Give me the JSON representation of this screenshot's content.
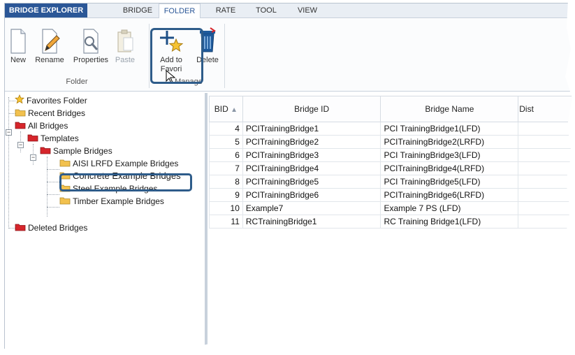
{
  "tabs": [
    "BRIDGE EXPLORER",
    "BRIDGE",
    "FOLDER",
    "RATE",
    "TOOL",
    "VIEW"
  ],
  "active_tab": "FOLDER",
  "ribbon": {
    "folder_group": {
      "label": "Folder",
      "buttons": [
        {
          "label": "New",
          "icon": "new-document-icon",
          "enabled": true
        },
        {
          "label": "Rename",
          "icon": "rename-pencil-icon",
          "enabled": true
        },
        {
          "label": "Properties",
          "icon": "properties-icon",
          "enabled": true
        },
        {
          "label": "Paste",
          "icon": "paste-icon",
          "enabled": false
        }
      ]
    },
    "manage_group": {
      "label": "Manage",
      "buttons": [
        {
          "label_line1": "Add to",
          "label_line2": "Favori",
          "icon": "add-star-icon",
          "enabled": true
        },
        {
          "label": "Delete",
          "icon": "trash-icon",
          "enabled": true
        }
      ]
    }
  },
  "tree": {
    "nodes": [
      {
        "label": "Favorites Folder",
        "icon": "star-icon"
      },
      {
        "label": "Recent Bridges",
        "icon": "folder-icon"
      },
      {
        "label": "All Bridges",
        "icon": "red-folder-icon"
      },
      {
        "label": "Templates",
        "icon": "red-folder-icon"
      },
      {
        "label": "Sample Bridges",
        "icon": "red-folder-icon"
      },
      {
        "label": "AISI LRFD Example Bridges",
        "icon": "folder-icon"
      },
      {
        "label": "Concrete Example Bridges",
        "icon": "folder-icon"
      },
      {
        "label": "Steel Example Bridges",
        "icon": "folder-icon"
      },
      {
        "label": "Timber Example Bridges",
        "icon": "folder-icon"
      },
      {
        "label": "Deleted Bridges",
        "icon": "red-folder-icon"
      }
    ],
    "selected": "Concrete Example Bridges"
  },
  "grid": {
    "columns": [
      "BID",
      "Bridge ID",
      "Bridge Name",
      "Dist"
    ],
    "sort_indicator": "▲",
    "rows": [
      {
        "bid": "4",
        "bridge_id": "PCITrainingBridge1",
        "bridge_name": "PCI TrainingBridge1(LFD)"
      },
      {
        "bid": "5",
        "bridge_id": "PCITrainingBridge2",
        "bridge_name": "PCITrainingBridge2(LRFD)"
      },
      {
        "bid": "6",
        "bridge_id": "PCITrainingBridge3",
        "bridge_name": "PCI TrainingBridge3(LFD)"
      },
      {
        "bid": "7",
        "bridge_id": "PCITrainingBridge4",
        "bridge_name": "PCITrainingBridge4(LRFD)"
      },
      {
        "bid": "8",
        "bridge_id": "PCITrainingBridge5",
        "bridge_name": "PCI TrainingBridge5(LFD)"
      },
      {
        "bid": "9",
        "bridge_id": "PCITrainingBridge6",
        "bridge_name": "PCITrainingBridge6(LRFD)"
      },
      {
        "bid": "10",
        "bridge_id": "Example7",
        "bridge_name": "Example 7 PS (LFD)"
      },
      {
        "bid": "11",
        "bridge_id": "RCTrainingBridge1",
        "bridge_name": "RC Training Bridge1(LFD)"
      }
    ]
  },
  "colors": {
    "app_tab": "#2b5797",
    "highlight": "#2e5c8a",
    "folder": "#f2c14e",
    "red_folder": "#d6252b"
  }
}
